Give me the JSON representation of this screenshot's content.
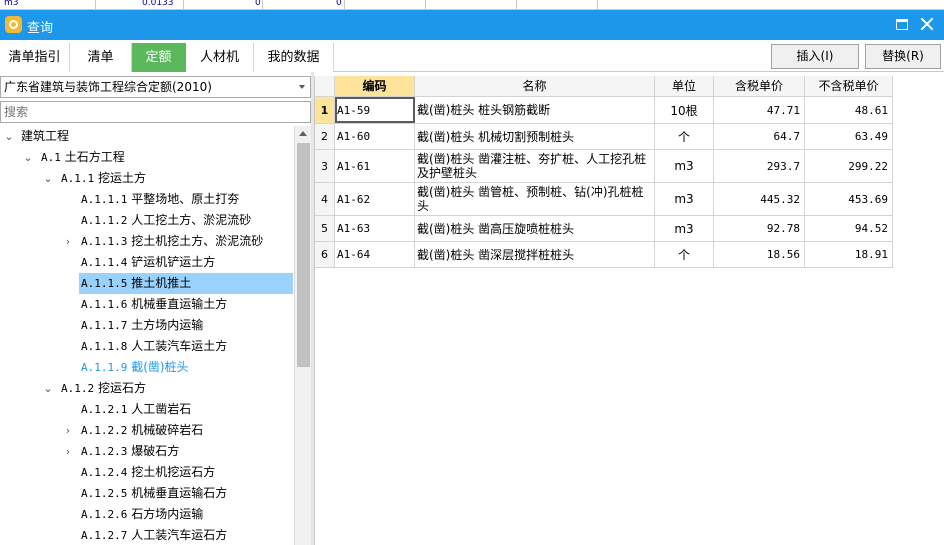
{
  "top_strip": {
    "unit": "m3",
    "value1": "0.0133",
    "value2": "0",
    "value3": "0"
  },
  "window": {
    "title": "查询"
  },
  "tabs": [
    {
      "label": "清单指引",
      "active": false
    },
    {
      "label": "清单",
      "active": false
    },
    {
      "label": "定额",
      "active": true
    },
    {
      "label": "人材机",
      "active": false
    },
    {
      "label": "我的数据",
      "active": false
    }
  ],
  "buttons": {
    "insert": "插入(I)",
    "replace": "替换(R)"
  },
  "library": {
    "selected": "广东省建筑与装饰工程综合定额(2010)"
  },
  "search": {
    "placeholder": "搜索"
  },
  "tree": [
    {
      "code": "",
      "label": "建筑工程",
      "level": 0,
      "expanded": true
    },
    {
      "code": "A.1",
      "label": "土石方工程",
      "level": 1,
      "expanded": true
    },
    {
      "code": "A.1.1",
      "label": "挖运土方",
      "level": 2,
      "expanded": true
    },
    {
      "code": "A.1.1.1",
      "label": "平整场地、原土打夯",
      "level": 3
    },
    {
      "code": "A.1.1.2",
      "label": "人工挖土方、淤泥流砂",
      "level": 3
    },
    {
      "code": "A.1.1.3",
      "label": "挖土机挖土方、淤泥流砂",
      "level": 3,
      "collapsed": true
    },
    {
      "code": "A.1.1.4",
      "label": "铲运机铲运土方",
      "level": 3
    },
    {
      "code": "A.1.1.5",
      "label": "推土机推土",
      "level": 3,
      "selected": true
    },
    {
      "code": "A.1.1.6",
      "label": "机械垂直运输土方",
      "level": 3
    },
    {
      "code": "A.1.1.7",
      "label": "土方场内运输",
      "level": 3
    },
    {
      "code": "A.1.1.8",
      "label": "人工装汽车运土方",
      "level": 3
    },
    {
      "code": "A.1.1.9",
      "label": "截(凿)桩头",
      "level": 3,
      "link": true
    },
    {
      "code": "A.1.2",
      "label": "挖运石方",
      "level": 2,
      "expanded": true
    },
    {
      "code": "A.1.2.1",
      "label": "人工凿岩石",
      "level": 3
    },
    {
      "code": "A.1.2.2",
      "label": "机械破碎岩石",
      "level": 3,
      "collapsed": true
    },
    {
      "code": "A.1.2.3",
      "label": "爆破石方",
      "level": 3,
      "collapsed": true
    },
    {
      "code": "A.1.2.4",
      "label": "挖土机挖运石方",
      "level": 3
    },
    {
      "code": "A.1.2.5",
      "label": "机械垂直运输石方",
      "level": 3
    },
    {
      "code": "A.1.2.6",
      "label": "石方场内运输",
      "level": 3
    },
    {
      "code": "A.1.2.7",
      "label": "人工装汽车运石方",
      "level": 3
    }
  ],
  "grid": {
    "headers": {
      "code": "编码",
      "name": "名称",
      "unit": "单位",
      "tax_price": "含税单价",
      "notax_price": "不含税单价"
    },
    "rows": [
      {
        "index": "1",
        "code": "A1-59",
        "name": "截(凿)桩头 桩头钢筋截断",
        "unit": "10根",
        "tax_price": "47.71",
        "notax_price": "48.61",
        "selected": true
      },
      {
        "index": "2",
        "code": "A1-60",
        "name": "截(凿)桩头 机械切割预制桩头",
        "unit": "个",
        "tax_price": "64.7",
        "notax_price": "63.49"
      },
      {
        "index": "3",
        "code": "A1-61",
        "name": "截(凿)桩头 凿灌注桩、夯扩桩、人工挖孔桩及护壁桩头",
        "unit": "m3",
        "tax_price": "293.7",
        "notax_price": "299.22"
      },
      {
        "index": "4",
        "code": "A1-62",
        "name": "截(凿)桩头 凿管桩、预制桩、钻(冲)孔桩桩头",
        "unit": "m3",
        "tax_price": "445.32",
        "notax_price": "453.69"
      },
      {
        "index": "5",
        "code": "A1-63",
        "name": "截(凿)桩头 凿高压旋喷桩桩头",
        "unit": "m3",
        "tax_price": "92.78",
        "notax_price": "94.52"
      },
      {
        "index": "6",
        "code": "A1-64",
        "name": "截(凿)桩头 凿深层搅拌桩桩头",
        "unit": "个",
        "tax_price": "18.56",
        "notax_price": "18.91"
      }
    ]
  },
  "colors": {
    "titlebar": "#1c97ea",
    "active_tab": "#5cb85c",
    "selection": "#99d1ff",
    "header_highlight": "#fde49a",
    "link": "#1c97ea"
  }
}
